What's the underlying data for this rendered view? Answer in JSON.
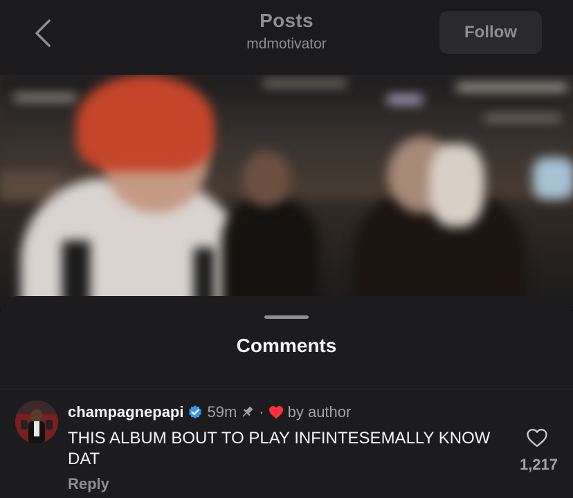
{
  "header": {
    "title": "Posts",
    "subtitle": "mdmotivator",
    "follow_label": "Follow",
    "back_icon": "chevron-left-icon"
  },
  "media": {
    "description_icon": "video-frame"
  },
  "comments_sheet": {
    "title": "Comments",
    "comments": [
      {
        "username": "champagnepapi",
        "verified": true,
        "time": "59m",
        "pinned": true,
        "separator": "·",
        "liked_by_author_label": "by author",
        "text": "THIS ALBUM BOUT TO PLAY INFINTESEMALLY KNOW DAT",
        "reply_label": "Reply",
        "like_count": "1,217"
      }
    ]
  },
  "colors": {
    "verified_blue": "#3797f0",
    "heart_red": "#ff3040",
    "sheet_bg": "#1c1c1e",
    "header_bg": "#1b1b1d"
  }
}
